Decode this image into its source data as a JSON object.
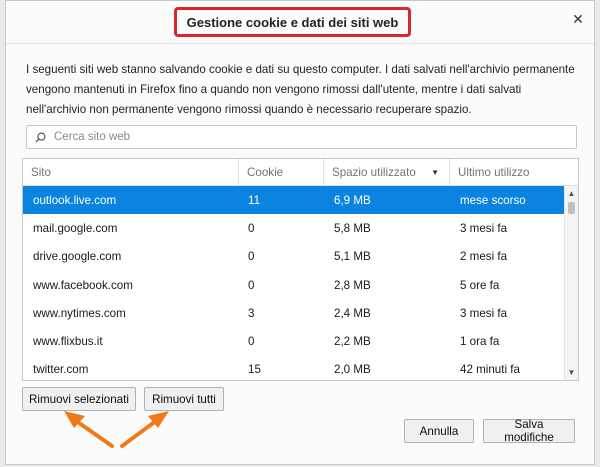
{
  "dialog": {
    "title": "Gestione cookie e dati dei siti web",
    "description": "I seguenti siti web stanno salvando cookie e dati su questo computer. I dati salvati nell'archivio permanente vengono mantenuti in Firefox fino a quando non vengono rimossi dall'utente, mentre i dati salvati nell'archivio non permanente vengono rimossi quando è necessario recuperare spazio.",
    "search_placeholder": "Cerca sito web"
  },
  "table": {
    "columns": [
      "Sito",
      "Cookie",
      "Spazio utilizzato",
      "Ultimo utilizzo"
    ],
    "rows": [
      {
        "site": "outlook.live.com",
        "cookie": "11",
        "space": "6,9 MB",
        "last": "mese scorso"
      },
      {
        "site": "mail.google.com",
        "cookie": "0",
        "space": "5,8 MB",
        "last": "3 mesi fa"
      },
      {
        "site": "drive.google.com",
        "cookie": "0",
        "space": "5,1 MB",
        "last": "2 mesi fa"
      },
      {
        "site": "www.facebook.com",
        "cookie": "0",
        "space": "2,8 MB",
        "last": "5 ore fa"
      },
      {
        "site": "www.nytimes.com",
        "cookie": "3",
        "space": "2,4 MB",
        "last": "3 mesi fa"
      },
      {
        "site": "www.flixbus.it",
        "cookie": "0",
        "space": "2,2 MB",
        "last": "1 ora fa"
      },
      {
        "site": "twitter.com",
        "cookie": "15",
        "space": "2,0 MB",
        "last": "42 minuti fa"
      }
    ]
  },
  "buttons": {
    "remove_selected": "Rimuovi selezionati",
    "remove_all": "Rimuovi tutti",
    "cancel": "Annulla",
    "save": "Salva modifiche"
  },
  "colors": {
    "selection": "#0a84e0",
    "title_highlight": "#d9262b",
    "arrow": "#f07a1a"
  }
}
